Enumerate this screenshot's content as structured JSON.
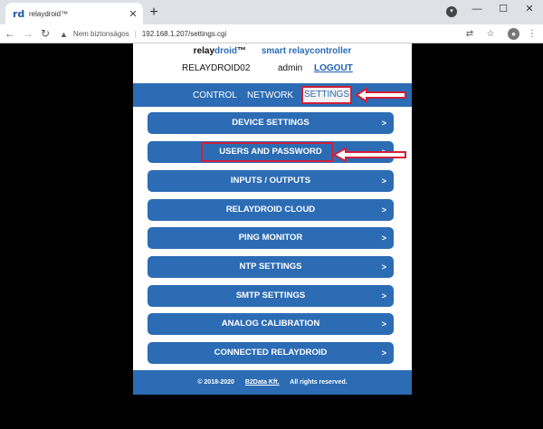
{
  "browser": {
    "tab_favicon": "rd",
    "tab_title": "relaydroid™",
    "close_glyph": "✕",
    "new_tab_glyph": "+",
    "security_label": "Nem biztonságos",
    "url": "192.168.1.207/settings.cgi",
    "icons": [
      "back-icon",
      "forward-icon",
      "reload-icon",
      "warning-icon",
      "translate-icon",
      "star-icon",
      "account-icon",
      "menu-icon",
      "minimize-icon",
      "maximize-icon",
      "close-icon"
    ]
  },
  "brand": {
    "name_a": "relay",
    "name_b": "droid",
    "tm": "™",
    "subtitle": "smart relaycontroller"
  },
  "user": {
    "device": "RELAYDROID02",
    "username": "admin",
    "logout": "LOGOUT"
  },
  "nav": {
    "items": [
      "CONTROL",
      "NETWORK",
      "SETTINGS"
    ],
    "active": "SETTINGS"
  },
  "menu": {
    "chevron": ">",
    "items": [
      "DEVICE SETTINGS",
      "USERS AND PASSWORD",
      "INPUTS / OUTPUTS",
      "RELAYDROID CLOUD",
      "PING MONITOR",
      "NTP SETTINGS",
      "SMTP SETTINGS",
      "ANALOG CALIBRATION",
      "CONNECTED RELAYDROID"
    ]
  },
  "footer": {
    "copyright": "© 2018-2020",
    "company": "B2Data Kft.",
    "rights": "All rights reserved."
  },
  "colors": {
    "primary": "#2c6cb4",
    "annotation": "#d0203a"
  }
}
